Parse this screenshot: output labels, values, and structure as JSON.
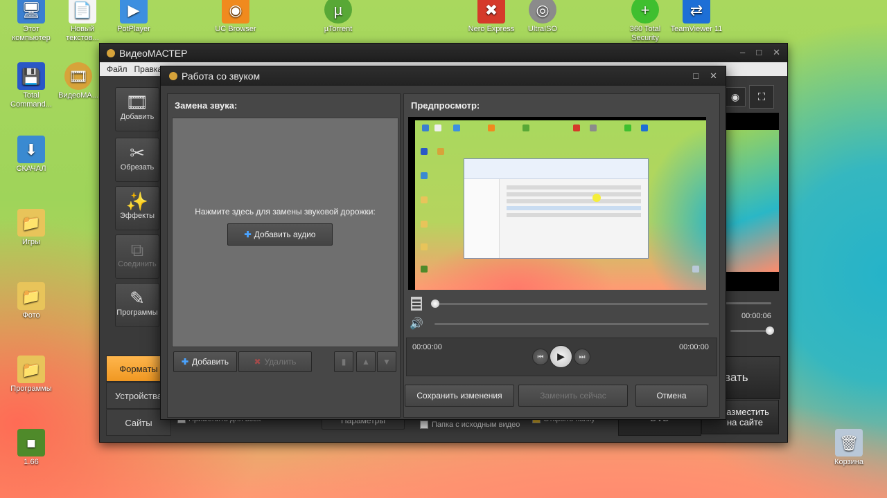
{
  "desktop": {
    "icons": [
      {
        "label": "Этот компьютер",
        "glyph": "🖥",
        "color": "#3a7fd1"
      },
      {
        "label": "Новый текстов...",
        "glyph": "📄",
        "color": "#f5f5f5"
      },
      {
        "label": "PotPlayer",
        "glyph": "▶",
        "color": "#3d8fe0"
      },
      {
        "label": "UC Browser",
        "glyph": "◉",
        "color": "#f08a1e"
      },
      {
        "label": "µTorrent",
        "glyph": "µ",
        "color": "#58a836"
      },
      {
        "label": "Nero Express",
        "glyph": "✖",
        "color": "#d53a2a"
      },
      {
        "label": "UltraISO",
        "glyph": "◎",
        "color": "#8b8b8b"
      },
      {
        "label": "360 Total Security",
        "glyph": "+",
        "color": "#3fbf2f"
      },
      {
        "label": "TeamViewer 11",
        "glyph": "⇄",
        "color": "#1d6fd6"
      },
      {
        "label": "Total Command...",
        "glyph": "💾",
        "color": "#2a58c7"
      },
      {
        "label": "ВидеоМА...",
        "glyph": "🎞",
        "color": "#d7a33a"
      },
      {
        "label": "СКАЧАЛ",
        "glyph": "⬇",
        "color": "#3a8ad1"
      },
      {
        "label": "Игры",
        "glyph": "📁",
        "color": "#e8c45a"
      },
      {
        "label": "Фото",
        "glyph": "📁",
        "color": "#e8c45a"
      },
      {
        "label": "Программы",
        "glyph": "📁",
        "color": "#e8c45a"
      },
      {
        "label": "1.66",
        "glyph": "■",
        "color": "#4f8a2a"
      },
      {
        "label": "Корзина",
        "glyph": "🗑",
        "color": "#b9c8d8"
      }
    ]
  },
  "main_window": {
    "title": "ВидеоМАСТЕР",
    "menu": [
      "Файл",
      "Правка"
    ],
    "sidebar": [
      {
        "label": "Добавить",
        "glyph": "🎞"
      },
      {
        "label": "Обрезать",
        "glyph": "✂"
      },
      {
        "label": "Эффекты",
        "glyph": "✨"
      },
      {
        "label": "Соединить",
        "glyph": "⧉"
      },
      {
        "label": "Программы",
        "glyph": "✎"
      }
    ],
    "tabs": [
      "Форматы",
      "Устройства",
      "Сайты"
    ],
    "bottom": {
      "apply_all": "Применить для всех",
      "params": "Параметры",
      "source_folder": "Папка с исходным видео",
      "open_folder": "Открыть папку",
      "convert": "вать",
      "dvd": "DVD",
      "publish": "Разместить на сайте",
      "time": "00:00:06"
    }
  },
  "dialog": {
    "title": "Работа со звуком",
    "sound_replace_label": "Замена звука:",
    "hint": "Нажмите здесь для замены звуковой дорожки:",
    "add_audio": "Добавить аудио",
    "add": "Добавить",
    "delete": "Удалить",
    "preview_label": "Предпросмотр:",
    "time_start": "00:00:00",
    "time_end": "00:00:00",
    "progress": 0,
    "volume": 0,
    "save": "Сохранить изменения",
    "replace_now": "Заменить сейчас",
    "cancel": "Отмена"
  }
}
